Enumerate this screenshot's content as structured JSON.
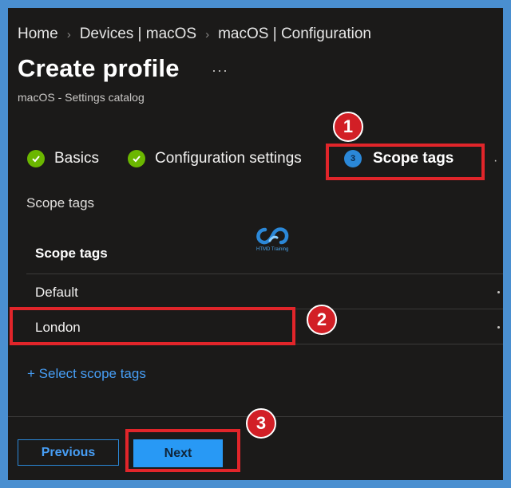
{
  "breadcrumb": [
    "Home",
    "Devices | macOS",
    "macOS | Configuration"
  ],
  "page": {
    "title": "Create profile",
    "more": "···",
    "subtitle": "macOS - Settings catalog"
  },
  "steps": [
    {
      "label": "Basics",
      "state": "complete",
      "icon": "check-circle-icon"
    },
    {
      "label": "Configuration settings",
      "state": "complete",
      "icon": "check-circle-icon"
    },
    {
      "label": "Scope tags",
      "state": "current",
      "number": "3"
    }
  ],
  "scope": {
    "section_label": "Scope tags",
    "column_header": "Scope tags",
    "rows": [
      "Default",
      "London"
    ],
    "select_link": "+ Select scope tags"
  },
  "footer": {
    "previous_label": "Previous",
    "next_label": "Next"
  },
  "watermark": {
    "text": "HTMD Training"
  },
  "annotations": [
    "1",
    "2",
    "3"
  ],
  "colors": {
    "background": "#1b1a19",
    "frame": "#4a8fd0",
    "accent": "#2899f5",
    "success": "#6bb700",
    "highlight": "#e1252a"
  }
}
